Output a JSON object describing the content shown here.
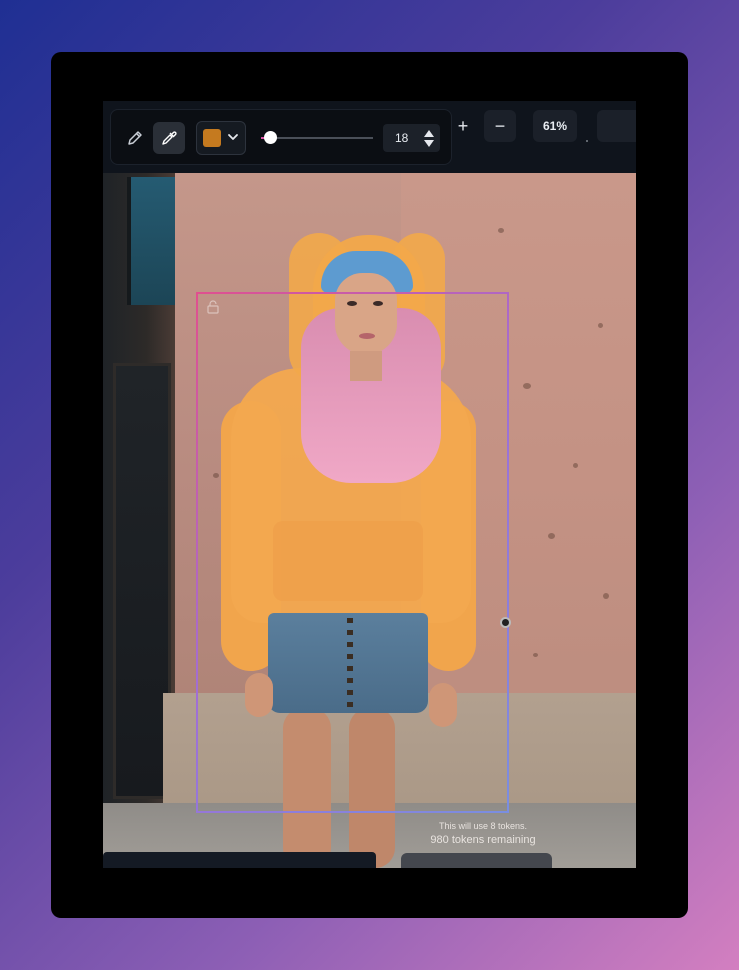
{
  "toolbar": {
    "pencil_icon": "pencil-icon",
    "eyedropper_icon": "eyedropper-icon",
    "brush_color": "#c57a1f",
    "brush_size": "18",
    "brush_size_fraction": 0.08
  },
  "zoom": {
    "plus_label": "+",
    "minus_label": "−",
    "level": "61%"
  },
  "canvas": {
    "mask_color": "#f5a94d",
    "selection_colors": [
      "#e0508f",
      "#9f6fd6",
      "#7a8ee0"
    ]
  },
  "footer": {
    "token_cost": "This will use 8 tokens.",
    "tokens_remaining": "980 tokens remaining"
  }
}
